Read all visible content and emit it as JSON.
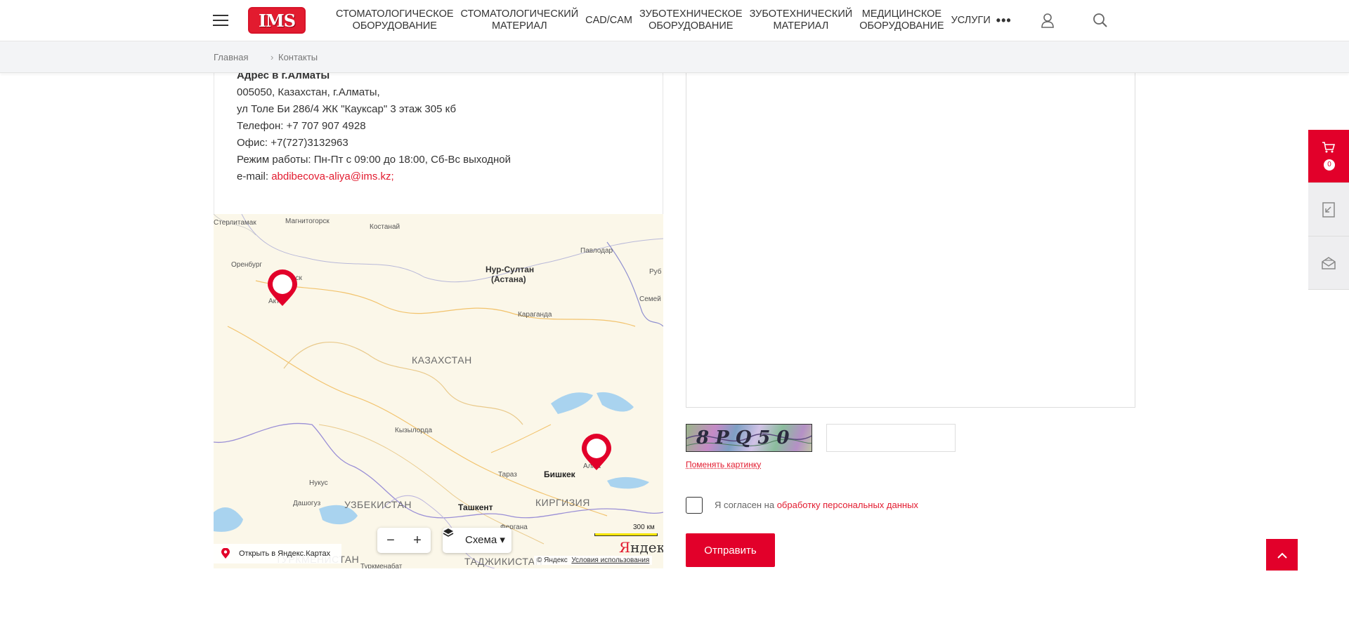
{
  "header": {
    "logo_text": "IMS",
    "nav": [
      {
        "line1": "СТОМАТОЛОГИЧЕСКОЕ",
        "line2": "ОБОРУДОВАНИЕ"
      },
      {
        "line1": "СТОМАТОЛОГИЧЕСКИЙ",
        "line2": "МАТЕРИАЛ"
      },
      {
        "line1": "CAD/CAM",
        "line2": ""
      },
      {
        "line1": "ЗУБОТЕХНИЧЕСКОЕ",
        "line2": "ОБОРУДОВАНИЕ"
      },
      {
        "line1": "ЗУБОТЕХНИЧЕСКИЙ",
        "line2": "МАТЕРИАЛ"
      },
      {
        "line1": "МЕДИЦИНСКОЕ",
        "line2": "ОБОРУДОВАНИЕ"
      },
      {
        "line1": "УСЛУГИ",
        "line2": ""
      }
    ],
    "more": "•••"
  },
  "breadcrumbs": {
    "home": "Главная",
    "separator": "›",
    "current": "Контакты"
  },
  "contact": {
    "heading": "Адрес в г.Алматы",
    "line1": "005050, Казахстан, г.Алматы,",
    "line2": "ул Толе Би 286/4 ЖК \"Кауксар\" 3 этаж 305 кб",
    "phone": "Телефон: +7 707 907 4928",
    "office": "Офис: +7(727)3132963",
    "hours": "Режим работы: Пн-Пт с 09:00 до 18:00, Сб-Вс выходной",
    "email_label": "e-mail: ",
    "email": "abdibecova-aliya@ims.kz;"
  },
  "map": {
    "labels": {
      "sterlitamak": "Стерлитамак",
      "magnitogorsk": "Магнитогорск",
      "kostanay": "Костанай",
      "pavlodar": "Павлодар",
      "orenburg": "Оренбург",
      "orsk": "рск",
      "aktobe": "Акт",
      "nursultan1": "Нур-Султан",
      "nursultan2": "(Астана)",
      "rub": "Руб",
      "semey": "Семей",
      "karaganda": "Караганда",
      "kazakhstan": "КАЗАХСТАН",
      "kyzylorda": "Кызылорда",
      "taraz": "Тараз",
      "bishkek": "Бишкек",
      "almaty": "Алма",
      "nukus": "Нукус",
      "uzbekistan": "УЗБЕКИСТАН",
      "kyrgyzstan": "КИРГИЗИЯ",
      "dashoguz": "Дашогуз",
      "tashkent": "Ташкент",
      "fergana": "Фергана",
      "turkmenistan": "ТУРКМЕНИСТАН",
      "tajikistan": "ТАДЖИКИСТАН",
      "turkmenabat": "Туркменабат"
    },
    "zoom_out": "−",
    "zoom_in": "+",
    "layer_button": "Схема ▾",
    "open_link": "Открыть в Яндекс.Картах",
    "scale": "300 км",
    "logo_y": "Я",
    "logo_rest": "ндекс",
    "copyright": "© Яндекс",
    "terms": "Условия использования"
  },
  "form": {
    "captcha_text": "8PQ50",
    "captcha_change": "Поменять картинку",
    "agree_text": "Я согласен на ",
    "agree_link": "обработку персональных данных",
    "submit": "Отправить"
  },
  "sidebar": {
    "cart_count": "0"
  },
  "colors": {
    "accent": "#e2002a"
  }
}
